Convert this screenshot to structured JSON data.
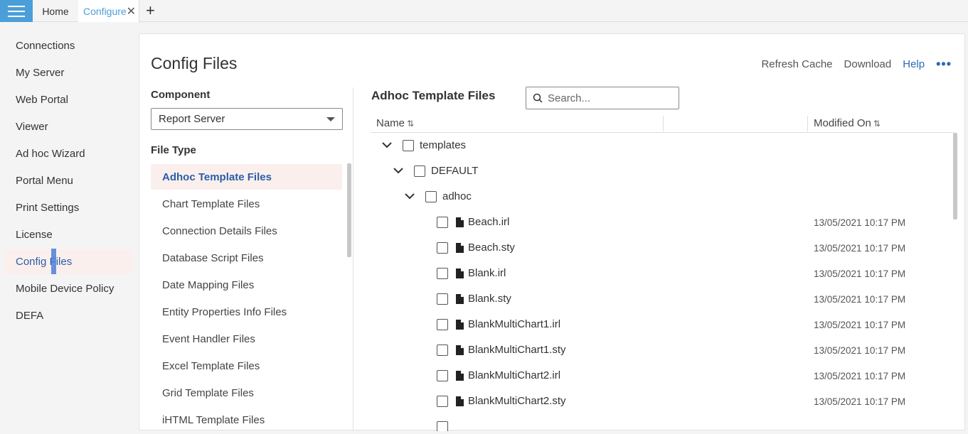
{
  "tabs": {
    "home": "Home",
    "configure": "Configure",
    "close": "✕",
    "add": "+"
  },
  "sidebar": {
    "items": [
      {
        "label": "Connections"
      },
      {
        "label": "My Server"
      },
      {
        "label": "Web Portal"
      },
      {
        "label": "Viewer"
      },
      {
        "label": "Ad hoc Wizard"
      },
      {
        "label": "Portal Menu"
      },
      {
        "label": "Print Settings"
      },
      {
        "label": "License"
      },
      {
        "label": "Config Files"
      },
      {
        "label": "Mobile Device Policy"
      },
      {
        "label": "DEFA"
      }
    ],
    "active_item": "Config Files"
  },
  "page": {
    "title": "Config Files",
    "actions": {
      "refresh": "Refresh Cache",
      "download": "Download",
      "help": "Help",
      "more": "•••"
    }
  },
  "component": {
    "label": "Component",
    "selected": "Report Server"
  },
  "file_type": {
    "label": "File Type",
    "items": [
      "Adhoc Template Files",
      "Chart Template Files",
      "Connection Details Files",
      "Database Script Files",
      "Date Mapping Files",
      "Entity Properties Info Files",
      "Event Handler Files",
      "Excel Template Files",
      "Grid Template Files",
      "iHTML Template Files"
    ],
    "active": "Adhoc Template Files"
  },
  "files": {
    "title": "Adhoc Template Files",
    "search_placeholder": "Search...",
    "columns": {
      "name": "Name",
      "modified": "Modified On"
    },
    "tree": [
      {
        "label": "templates"
      },
      {
        "label": "DEFAULT"
      },
      {
        "label": "adhoc"
      }
    ],
    "rows": [
      {
        "name": "Beach.irl",
        "modified": "13/05/2021 10:17 PM"
      },
      {
        "name": "Beach.sty",
        "modified": "13/05/2021 10:17 PM"
      },
      {
        "name": "Blank.irl",
        "modified": "13/05/2021 10:17 PM"
      },
      {
        "name": "Blank.sty",
        "modified": "13/05/2021 10:17 PM"
      },
      {
        "name": "BlankMultiChart1.irl",
        "modified": "13/05/2021 10:17 PM"
      },
      {
        "name": "BlankMultiChart1.sty",
        "modified": "13/05/2021 10:17 PM"
      },
      {
        "name": "BlankMultiChart2.irl",
        "modified": "13/05/2021 10:17 PM"
      },
      {
        "name": "BlankMultiChart2.sty",
        "modified": "13/05/2021 10:17 PM"
      }
    ]
  },
  "colors": {
    "accent": "#4a9fd8",
    "link": "#2a6bb8",
    "active_bg": "#fbefed"
  }
}
